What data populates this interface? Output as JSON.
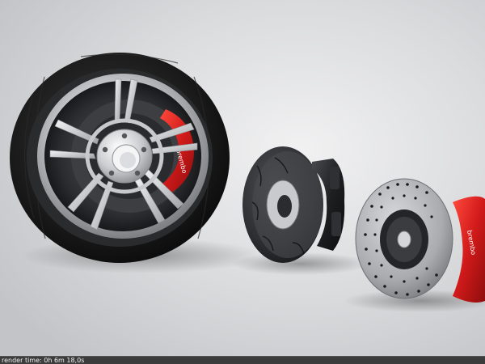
{
  "scene": {
    "subjects": [
      "wheel-with-red-caliper",
      "slotted-brake-disc-with-black-caliper",
      "drilled-brake-disc-with-red-caliper"
    ],
    "background_color": "#e3e4e6",
    "accent_red": "#d11a1a",
    "caliper_black": "#1e1f21",
    "caliper_brand": "brembo"
  },
  "status_bar": {
    "text": "render time: 0h 6m 18,0s"
  }
}
